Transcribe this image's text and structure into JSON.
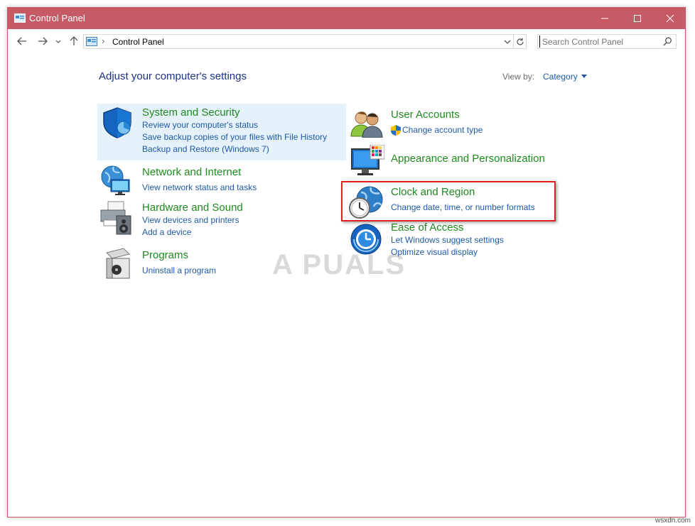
{
  "window": {
    "title": "Control Panel"
  },
  "address": {
    "crumb": "Control Panel",
    "search_placeholder": "Search Control Panel"
  },
  "header": {
    "heading": "Adjust your computer's settings",
    "view_by_label": "View by:",
    "view_by_value": "Category"
  },
  "categories": {
    "system_security": {
      "title": "System and Security",
      "links": [
        "Review your computer's status",
        "Save backup copies of your files with File History",
        "Backup and Restore (Windows 7)"
      ]
    },
    "network": {
      "title": "Network and Internet",
      "links": [
        "View network status and tasks"
      ]
    },
    "hardware": {
      "title": "Hardware and Sound",
      "links": [
        "View devices and printers",
        "Add a device"
      ]
    },
    "programs": {
      "title": "Programs",
      "links": [
        "Uninstall a program"
      ]
    },
    "user_accounts": {
      "title": "User Accounts",
      "links": [
        "Change account type"
      ]
    },
    "appearance": {
      "title": "Appearance and Personalization",
      "links": []
    },
    "clock_region": {
      "title": "Clock and Region",
      "links": [
        "Change date, time, or number formats"
      ]
    },
    "ease_access": {
      "title": "Ease of Access",
      "links": [
        "Let Windows suggest settings",
        "Optimize visual display"
      ]
    }
  },
  "watermark": "A PUALS",
  "site_mark": "wsxdn.com",
  "colors": {
    "titlebar": "#c65b66",
    "link": "#1e5aa8",
    "category_title": "#1f8a1f",
    "highlight": "#e5f1fb",
    "annotation": "#e02020"
  }
}
